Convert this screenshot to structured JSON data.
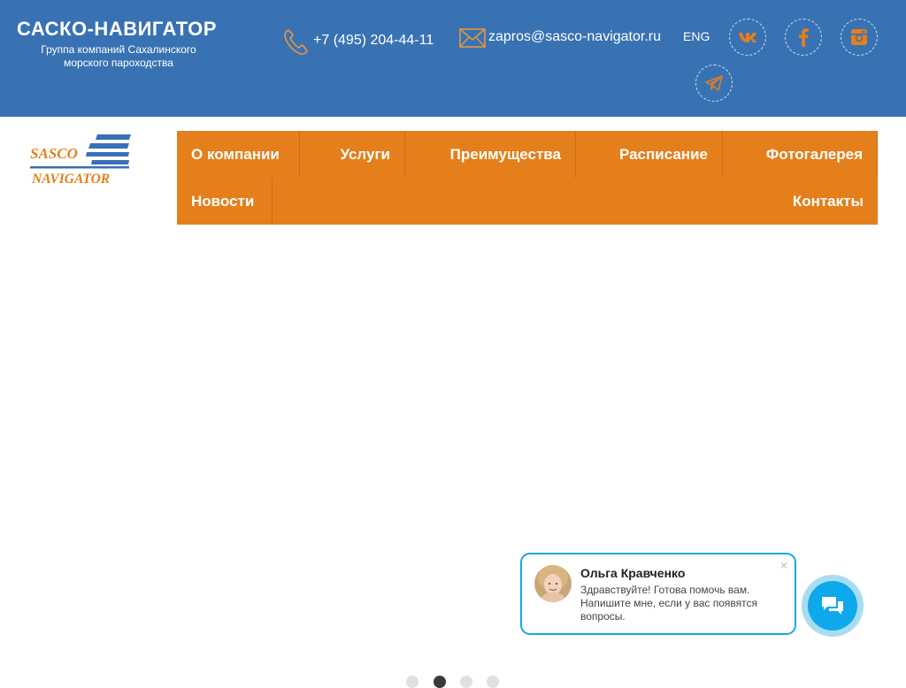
{
  "header": {
    "brand_title": "САСКО-НАВИГАТОР",
    "brand_subtitle": "Группа компаний Сахалинского морского пароходства",
    "phone": "+7 (495) 204-44-11",
    "email": "zapros@sasco-navigator.ru",
    "lang": "ENG",
    "socials": [
      {
        "name": "vk",
        "icon": "vk-icon"
      },
      {
        "name": "facebook",
        "icon": "facebook-icon"
      },
      {
        "name": "instagram",
        "icon": "instagram-icon"
      },
      {
        "name": "telegram",
        "icon": "telegram-icon"
      }
    ]
  },
  "logo": {
    "line1": "SASCO",
    "line2": "NAVIGATOR"
  },
  "nav": {
    "items": [
      "О компании",
      "Услуги",
      "Преимущества",
      "Расписание",
      "Фотогалерея",
      "Новости",
      "Контакты"
    ]
  },
  "slider": {
    "dots": 4,
    "active_index": 1
  },
  "chat": {
    "name": "Ольга Кравченко",
    "message": "Здравствуйте! Готова помочь вам. Напишите мне, если у вас появятся вопросы.",
    "close": "×"
  },
  "colors": {
    "header_bg": "#3872b3",
    "nav_bg": "#e57f1b",
    "accent_orange": "#e57f1b",
    "chat_blue": "#0ea9ea"
  }
}
